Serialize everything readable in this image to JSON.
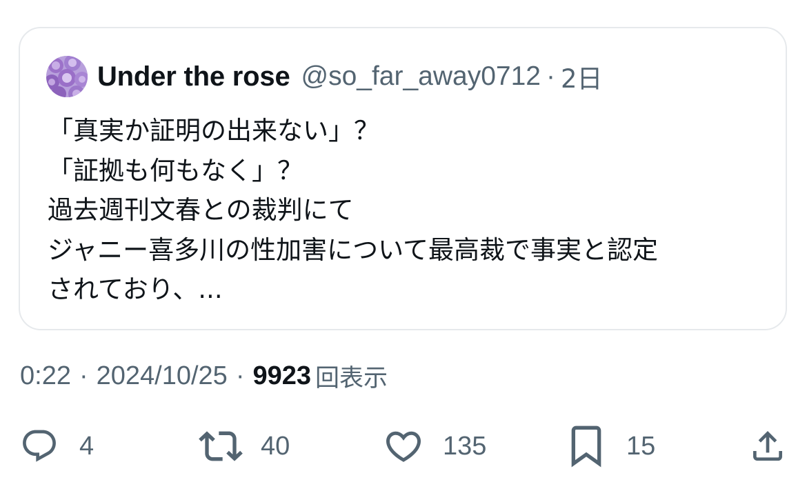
{
  "quoted_tweet": {
    "display_name": "Under the rose",
    "handle": "@so_far_away0712",
    "separator": "·",
    "time_ago": "2日",
    "text_lines": [
      "「真実か証明の出来ない」？",
      "「証拠も何もなく」？",
      "過去週刊文春との裁判にて",
      "ジャニー喜多川の性加害について最高裁で事実と認定",
      "されており、..."
    ],
    "avatar_icon": "purple-rose-avatar-icon"
  },
  "meta": {
    "time": "0:22",
    "separator": "·",
    "date": "2024/10/25",
    "views_count": "9923",
    "views_label": "回表示"
  },
  "actions": {
    "reply": {
      "icon": "reply-icon",
      "count": "4"
    },
    "retweet": {
      "icon": "retweet-icon",
      "count": "40"
    },
    "like": {
      "icon": "heart-icon",
      "count": "135"
    },
    "bookmark": {
      "icon": "bookmark-icon",
      "count": "15"
    },
    "share": {
      "icon": "share-icon"
    }
  },
  "colors": {
    "text_primary": "#0f1419",
    "text_secondary": "#536471",
    "border": "#e6e9ec",
    "avatar": "#b79ad8"
  }
}
